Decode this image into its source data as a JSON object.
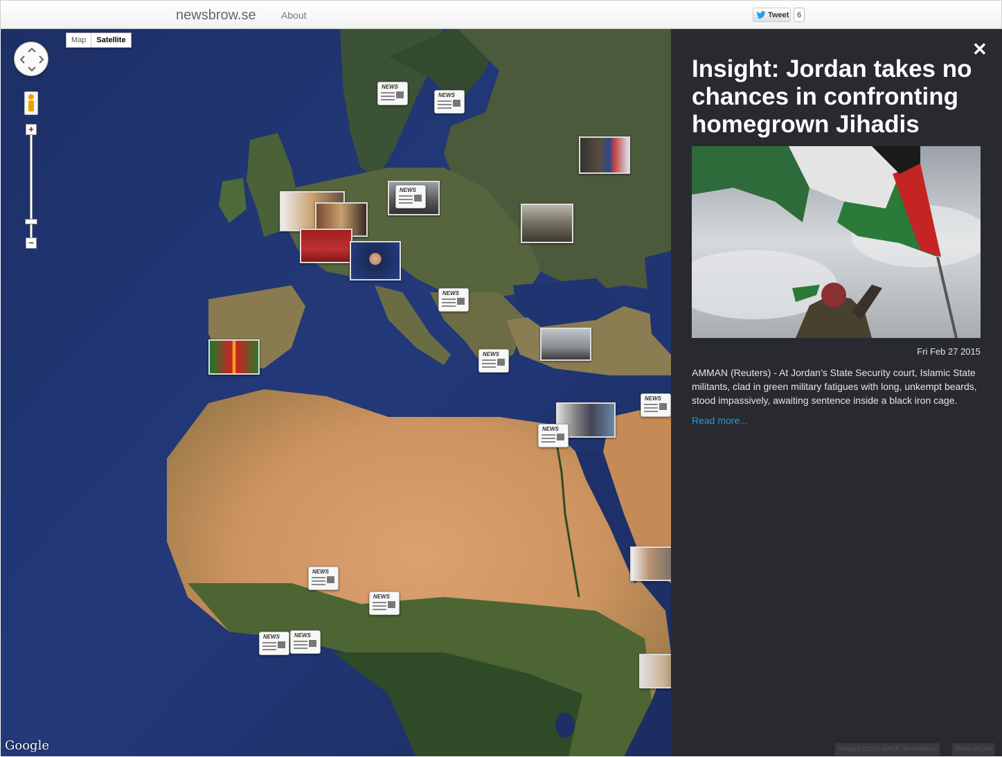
{
  "nav": {
    "brand": "newsbrow.se",
    "about": "About",
    "tweet_label": "Tweet",
    "tweet_count": "6"
  },
  "map": {
    "type_buttons": [
      "Map",
      "Satellite"
    ],
    "active_type": "Satellite",
    "zoom_in": "+",
    "zoom_out": "−",
    "attribution": "Google",
    "imagery": "Imagery ©2015 NASA, TerraMetrics",
    "terms": "Terms of Use",
    "news_icon_label": "NEWS"
  },
  "article": {
    "title": "Insight: Jordan takes no chances in confronting homegrown Jihadis",
    "date": "Fri Feb 27 2015",
    "summary": "AMMAN (Reuters) - At Jordan’s State Security court, Islamic State militants, clad in green military fatigues with long, unkempt beards, stood impassively, awaiting sentence inside a black iron cage.",
    "read_more": "Read more...",
    "close": "✕"
  },
  "colors": {
    "ocean": "#21356e",
    "desert": "#d59a62",
    "forest": "#3f5a32",
    "panel": "#16181e",
    "link": "#2f97e0"
  }
}
